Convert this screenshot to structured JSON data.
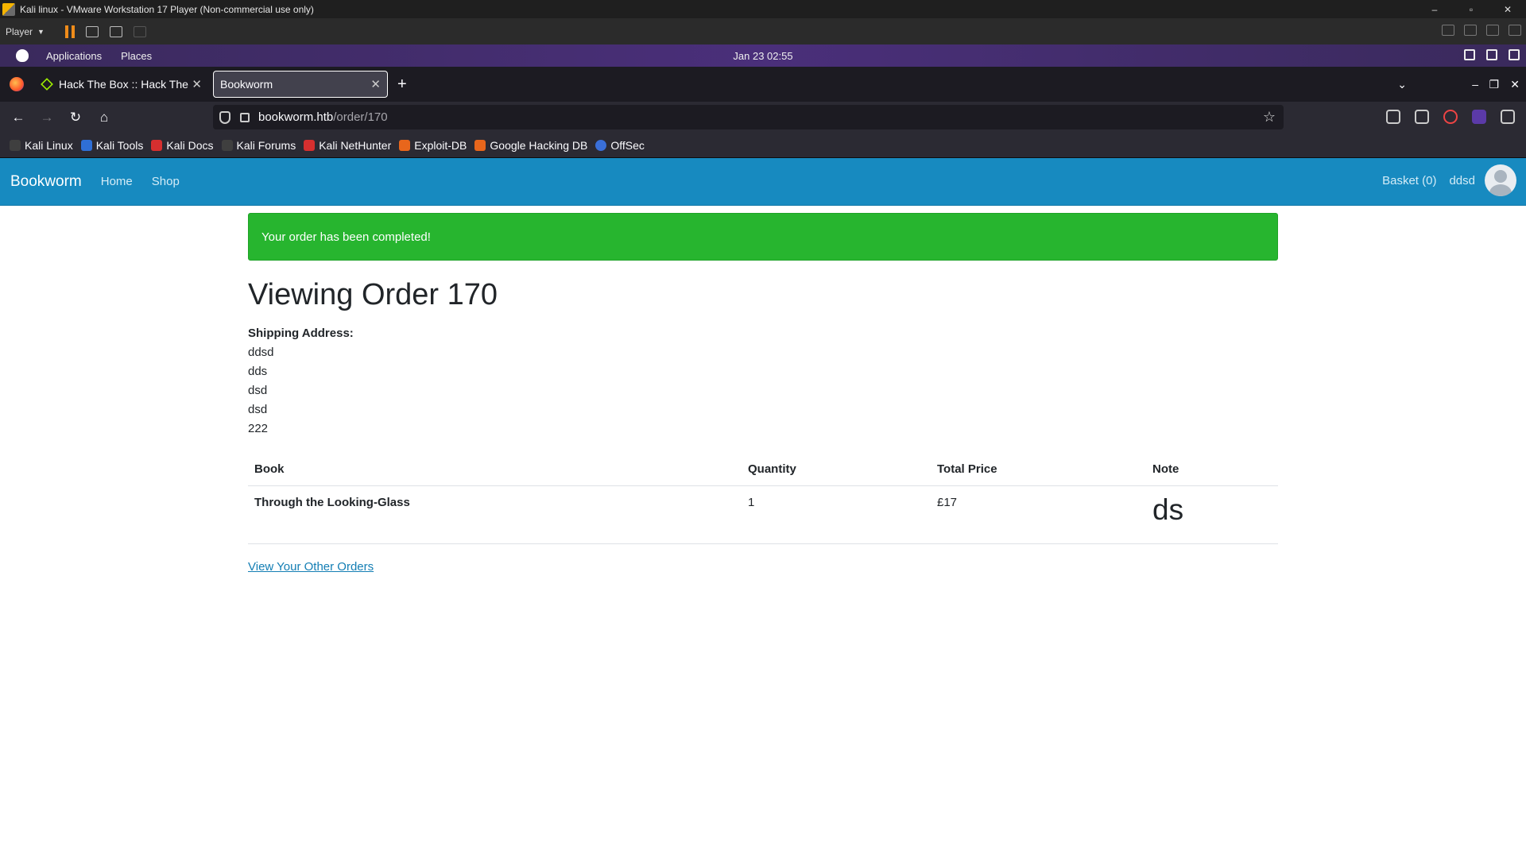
{
  "vmware": {
    "window_title": "Kali linux - VMware Workstation 17 Player (Non-commercial use only)",
    "player_menu": "Player",
    "minimize": "–",
    "maximize": "▫",
    "close": "✕"
  },
  "kali_panel": {
    "applications": "Applications",
    "places": "Places",
    "clock": "Jan 23  02:55"
  },
  "browser": {
    "tabs": [
      {
        "label": "Hack The Box :: Hack The",
        "close": "✕"
      },
      {
        "label": "Bookworm",
        "close": "✕"
      }
    ],
    "new_tab": "+",
    "tab_list": "⌄",
    "win_min": "–",
    "win_max": "❐",
    "win_close": "✕",
    "nav": {
      "back": "←",
      "forward": "→",
      "reload": "↻",
      "home": "⌂"
    },
    "url_host": "bookworm.htb",
    "url_path": "/order/170",
    "star": "☆",
    "bookmarks": [
      {
        "label": "Kali Linux",
        "color": "#3f3f3f"
      },
      {
        "label": "Kali Tools",
        "color": "#2f6fd6"
      },
      {
        "label": "Kali Docs",
        "color": "#d62f2f"
      },
      {
        "label": "Kali Forums",
        "color": "#3f3f3f"
      },
      {
        "label": "Kali NetHunter",
        "color": "#d62f2f"
      },
      {
        "label": "Exploit-DB",
        "color": "#e8661c"
      },
      {
        "label": "Google Hacking DB",
        "color": "#e8661c"
      },
      {
        "label": "OffSec",
        "color": "#3a6fd8"
      }
    ]
  },
  "site": {
    "brand": "Bookworm",
    "nav_home": "Home",
    "nav_shop": "Shop",
    "basket": "Basket (0)",
    "username": "ddsd",
    "accent_color": "#178ac0"
  },
  "order": {
    "alert": "Your order has been completed!",
    "title": "Viewing Order 170",
    "shipping_label": "Shipping Address:",
    "address_lines": [
      "ddsd",
      "dds",
      "dsd",
      "dsd",
      "222"
    ],
    "table_headers": {
      "book": "Book",
      "quantity": "Quantity",
      "total_price": "Total Price",
      "note": "Note"
    },
    "items": [
      {
        "book": "Through the Looking-Glass",
        "quantity": "1",
        "total_price": "£17",
        "note": "ds"
      }
    ],
    "other_orders_link": "View Your Other Orders"
  }
}
